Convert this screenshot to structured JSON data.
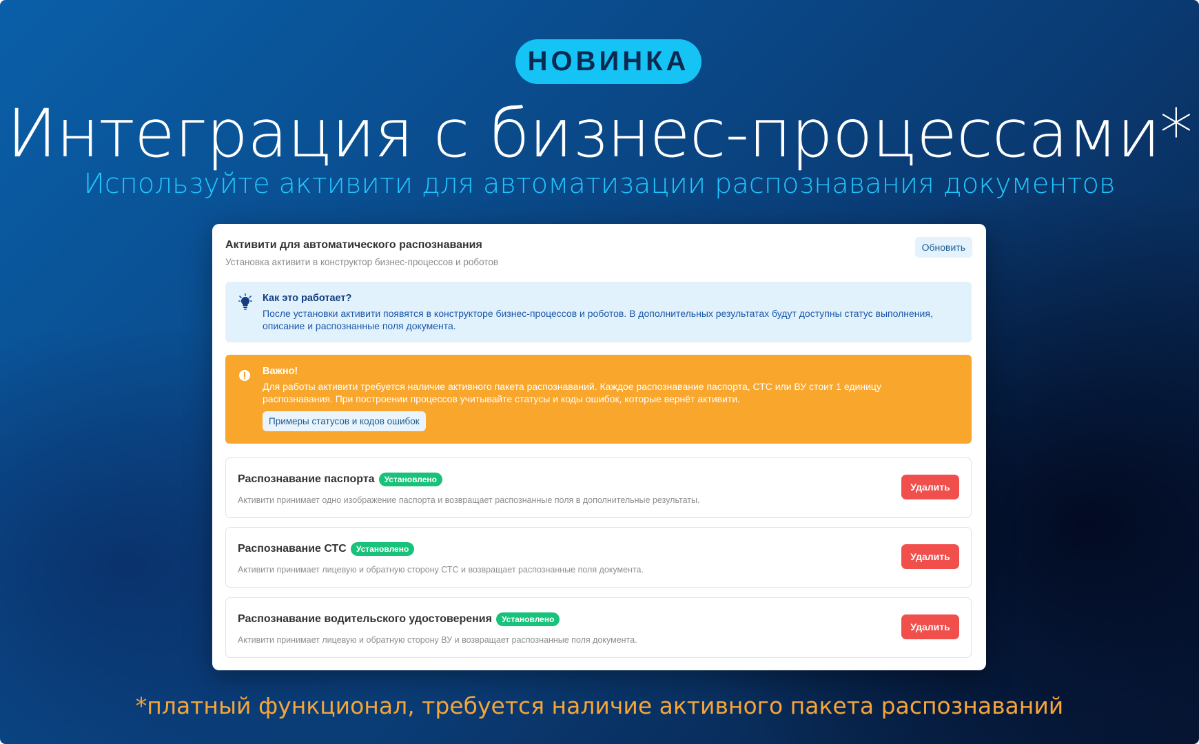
{
  "banner": {
    "badge": "НОВИНКА",
    "headline": "Интеграция с бизнес-процессами*",
    "subline": "Используйте активити для автоматизации распознавания документов",
    "footnote": "*платный функционал, требуется наличие активного пакета распознаваний"
  },
  "card": {
    "title": "Активити для автоматического распознавания",
    "subtitle": "Установка активити в конструктор бизнес-процессов и роботов",
    "refresh_label": "Обновить",
    "info": {
      "icon": "lightbulb-icon",
      "title": "Как это работает?",
      "text": "После установки активити появятся в конструкторе бизнес-процессов и роботов. В дополнительных результатах будут доступны статус выполнения, описание и распознанные поля документа."
    },
    "warning": {
      "icon": "alert-circle-icon",
      "title": "Важно!",
      "text": "Для работы активити требуется наличие активного пакета распознаваний. Каждое распознавание паспорта, СТС или ВУ стоит 1 единицу распознавания. При построении процессов учитывайте статусы и коды ошибок, которые вернёт активити.",
      "button_label": "Примеры статусов и кодов ошибок"
    },
    "items": [
      {
        "title": "Распознавание паспорта",
        "status": "Установлено",
        "description": "Активити принимает одно изображение паспорта и возвращает распознанные поля в дополнительные результаты.",
        "delete_label": "Удалить"
      },
      {
        "title": "Распознавание СТС",
        "status": "Установлено",
        "description": "Активити принимает лицевую и обратную сторону СТС и возвращает распознанные поля документа.",
        "delete_label": "Удалить"
      },
      {
        "title": "Распознавание водительского удостоверения",
        "status": "Установлено",
        "description": "Активити принимает лицевую и обратную сторону ВУ и возвращает распознанные поля документа.",
        "delete_label": "Удалить"
      }
    ]
  },
  "colors": {
    "badge": "#16c3f5",
    "subline": "#20c6ff",
    "footnote": "#f5a53a",
    "warning": "#f9a62c",
    "info_bg": "#e2f2fd",
    "status_installed": "#19c27a",
    "delete": "#f04f4c"
  }
}
